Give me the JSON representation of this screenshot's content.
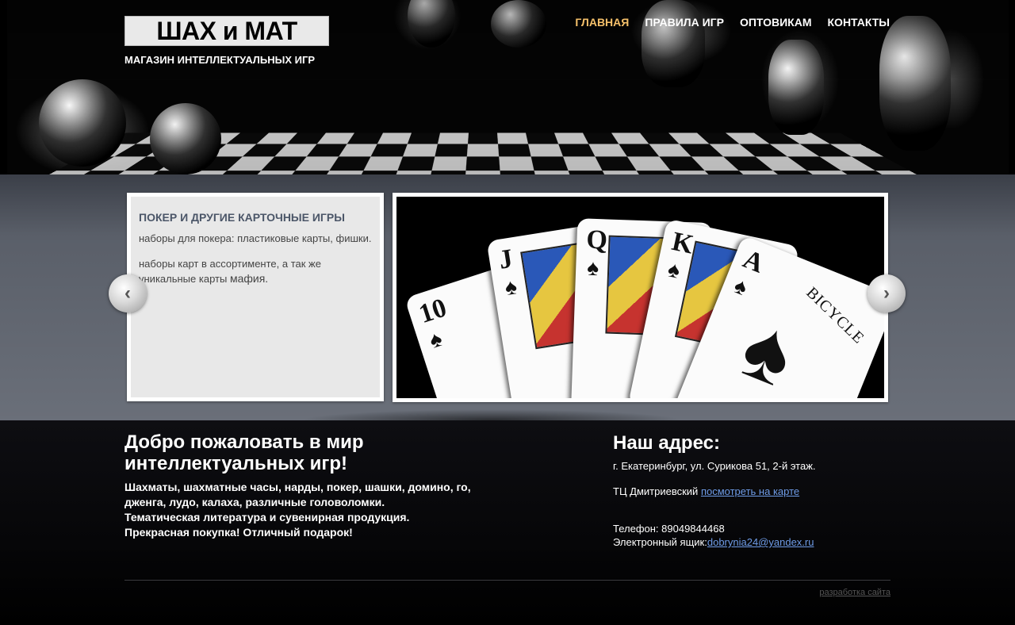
{
  "header": {
    "logo": "ШАХ и МАТ",
    "tagline": "МАГАЗИН ИНТЕЛЛЕКТУАЛЬНЫХ ИГР",
    "nav": [
      {
        "label": "ГЛАВНАЯ",
        "active": true
      },
      {
        "label": "ПРАВИЛА ИГР",
        "active": false
      },
      {
        "label": "ОПТОВИКАМ",
        "active": false
      },
      {
        "label": "КОНТАКТЫ",
        "active": false
      }
    ]
  },
  "slider": {
    "panel_title": "ПОКЕР И ДРУГИЕ КАРТОЧНЫЕ ИГРЫ",
    "panel_text1": "наборы для покера: пластиковые карты, фишки.",
    "panel_text2": "наборы карт в ассортименте, а так же уникальные карты",
    "panel_text2_emph": "мафия.",
    "cards": {
      "ranks": [
        "10",
        "J",
        "Q",
        "K",
        "A"
      ],
      "brand": "BICYCLE"
    },
    "prev_icon": "chevron-left-icon",
    "next_icon": "chevron-right-icon"
  },
  "welcome": {
    "title": "Добро пожаловать в мир интеллектуальных игр!",
    "lines": [
      "Шахматы, шахматные часы, нарды, покер, шашки, домино, го,",
      "дженга, лудо, калаха, различные головоломки.",
      "Тематическая литература и сувенирная продукция.",
      "Прекрасная покупка! Отличный подарок!"
    ]
  },
  "address": {
    "title": "Наш адрес:",
    "street": "г. Екатеринбург, ул. Сурикова 51, 2-й этаж.",
    "mall": "ТЦ Дмитриевский",
    "map_link": "посмотреть на карте",
    "phone": "Телефон: 89049844468",
    "email_label": "Электронный ящик:",
    "email": "dobrynia24@yandex.ru"
  },
  "footer": {
    "dev_link": "разработка сайта"
  },
  "colors": {
    "nav_active": "#f5c06a",
    "link": "#6e9be6",
    "panel_title": "#4b5668"
  }
}
